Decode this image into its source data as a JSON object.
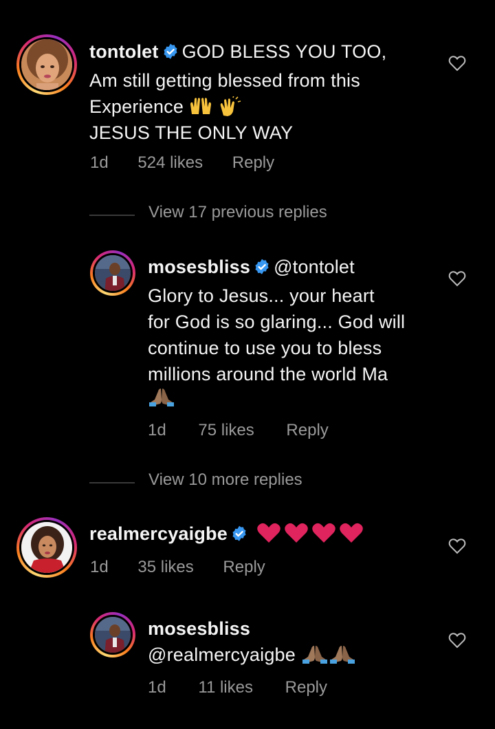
{
  "comments": [
    {
      "username": "tontolet",
      "verified": true,
      "text_line1": "GOD BLESS YOU TOO,",
      "text_line2": "Am still getting blessed from this",
      "text_line3": "Experience",
      "text_line4": "JESUS THE ONLY WAY",
      "time": "1d",
      "likes": "524 likes",
      "reply": "Reply",
      "view_replies": "View 17 previous replies"
    },
    {
      "username": "mosesbliss",
      "verified": true,
      "mention": "@tontolet",
      "text_line1": "Glory to Jesus... your heart",
      "text_line2": "for God is so glaring... God will",
      "text_line3": "continue to use you to bless",
      "text_line4": "millions around the world Ma",
      "time": "1d",
      "likes": "75 likes",
      "reply": "Reply",
      "view_replies": "View 10 more replies"
    },
    {
      "username": "realmercyaigbe",
      "verified": true,
      "time": "1d",
      "likes": "35 likes",
      "reply": "Reply"
    },
    {
      "username": "mosesbliss",
      "verified": false,
      "mention": "@realmercyaigbe",
      "time": "1d",
      "likes": "11 likes",
      "reply": "Reply"
    }
  ],
  "colors": {
    "background": "#000000",
    "text": "#f5f5f5",
    "muted": "#9a9a9a",
    "verified": "#3897f0",
    "heart_emoji": "#e0245e"
  },
  "icons": {
    "verified": "verified-badge-icon",
    "like": "heart-outline-icon",
    "praise": "raised-hands-emoji",
    "clap": "clapping-hands-emoji",
    "pray": "folded-hands-emoji",
    "love": "red-heart-emoji"
  }
}
